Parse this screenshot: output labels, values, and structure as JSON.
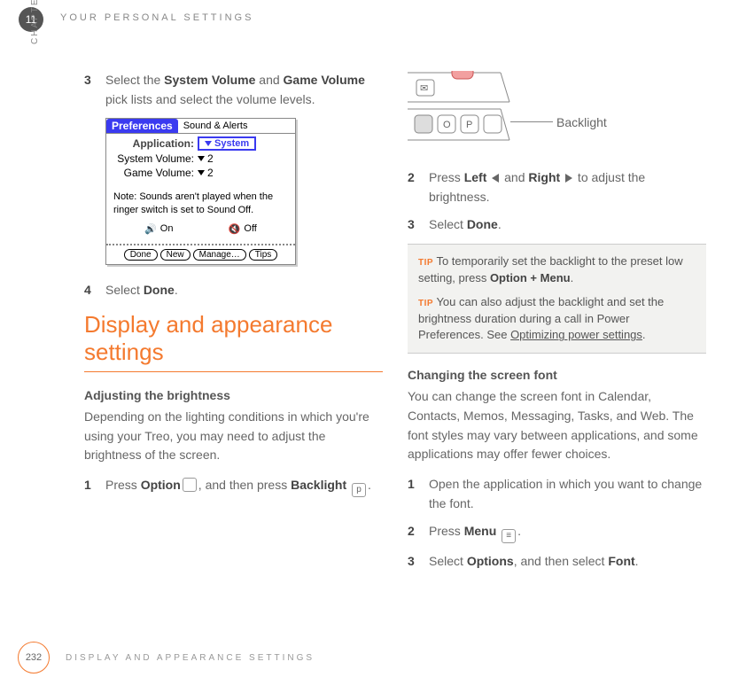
{
  "header": {
    "chapter_number": "11",
    "chapter_label": "CHAPTER",
    "page_title": "YOUR PERSONAL SETTINGS"
  },
  "left": {
    "step3_num": "3",
    "step3_a": "Select the ",
    "step3_b": "System Volume",
    "step3_c": " and ",
    "step3_d": "Game Volume",
    "step3_e": " pick lists and select the volume levels.",
    "step4_num": "4",
    "step4_a": "Select ",
    "step4_b": "Done",
    "step4_c": ".",
    "prefs": {
      "tab": "Preferences",
      "subtitle": "Sound & Alerts",
      "app_label": "Application:",
      "app_value": "System",
      "sysvol_label": "System Volume:",
      "sysvol_value": "2",
      "gamevol_label": "Game Volume:",
      "gamevol_value": "2",
      "note": "Note: Sounds aren't played when the ringer switch is set to Sound Off.",
      "on": "On",
      "off": "Off",
      "btn_done": "Done",
      "btn_new": "New",
      "btn_manage": "Manage…",
      "btn_tips": "Tips"
    },
    "section_title": "Display and appearance settings",
    "sub1": "Adjusting the brightness",
    "sub1_para": "Depending on the lighting conditions in which you're using your Treo, you may need to adjust the brightness of the screen.",
    "s1_num": "1",
    "s1_a": "Press ",
    "s1_b": "Option",
    "s1_c": ", and then press ",
    "s1_d": "Backlight",
    "s1_e": "."
  },
  "right": {
    "backlight_label": "Backlight",
    "s2_num": "2",
    "s2_a": "Press ",
    "s2_b": "Left",
    "s2_c": " and ",
    "s2_d": "Right",
    "s2_e": " to adjust the brightness.",
    "s3_num": "3",
    "s3_a": "Select ",
    "s3_b": "Done",
    "s3_c": ".",
    "tip1_label": "TIP",
    "tip1_a": " To temporarily set the backlight to the preset low setting, press ",
    "tip1_b": "Option + Menu",
    "tip1_c": ".",
    "tip2_label": "TIP",
    "tip2_a": " You can also adjust the backlight and set the brightness duration during a call in Power Preferences. See ",
    "tip2_link": "Optimizing power settings",
    "tip2_c": ".",
    "sub2": "Changing the screen font",
    "sub2_para": "You can change the screen font in Calendar, Contacts, Memos, Messaging, Tasks, and Web. The font styles may vary between applications, and some applications may offer fewer choices.",
    "f1_num": "1",
    "f1_text": "Open the application in which you want to change the font.",
    "f2_num": "2",
    "f2_a": "Press ",
    "f2_b": "Menu",
    "f2_c": ".",
    "f3_num": "3",
    "f3_a": "Select ",
    "f3_b": "Options",
    "f3_c": ", and then select ",
    "f3_d": "Font",
    "f3_e": "."
  },
  "footer": {
    "page_number": "232",
    "footer_text": "DISPLAY AND APPEARANCE SETTINGS"
  }
}
